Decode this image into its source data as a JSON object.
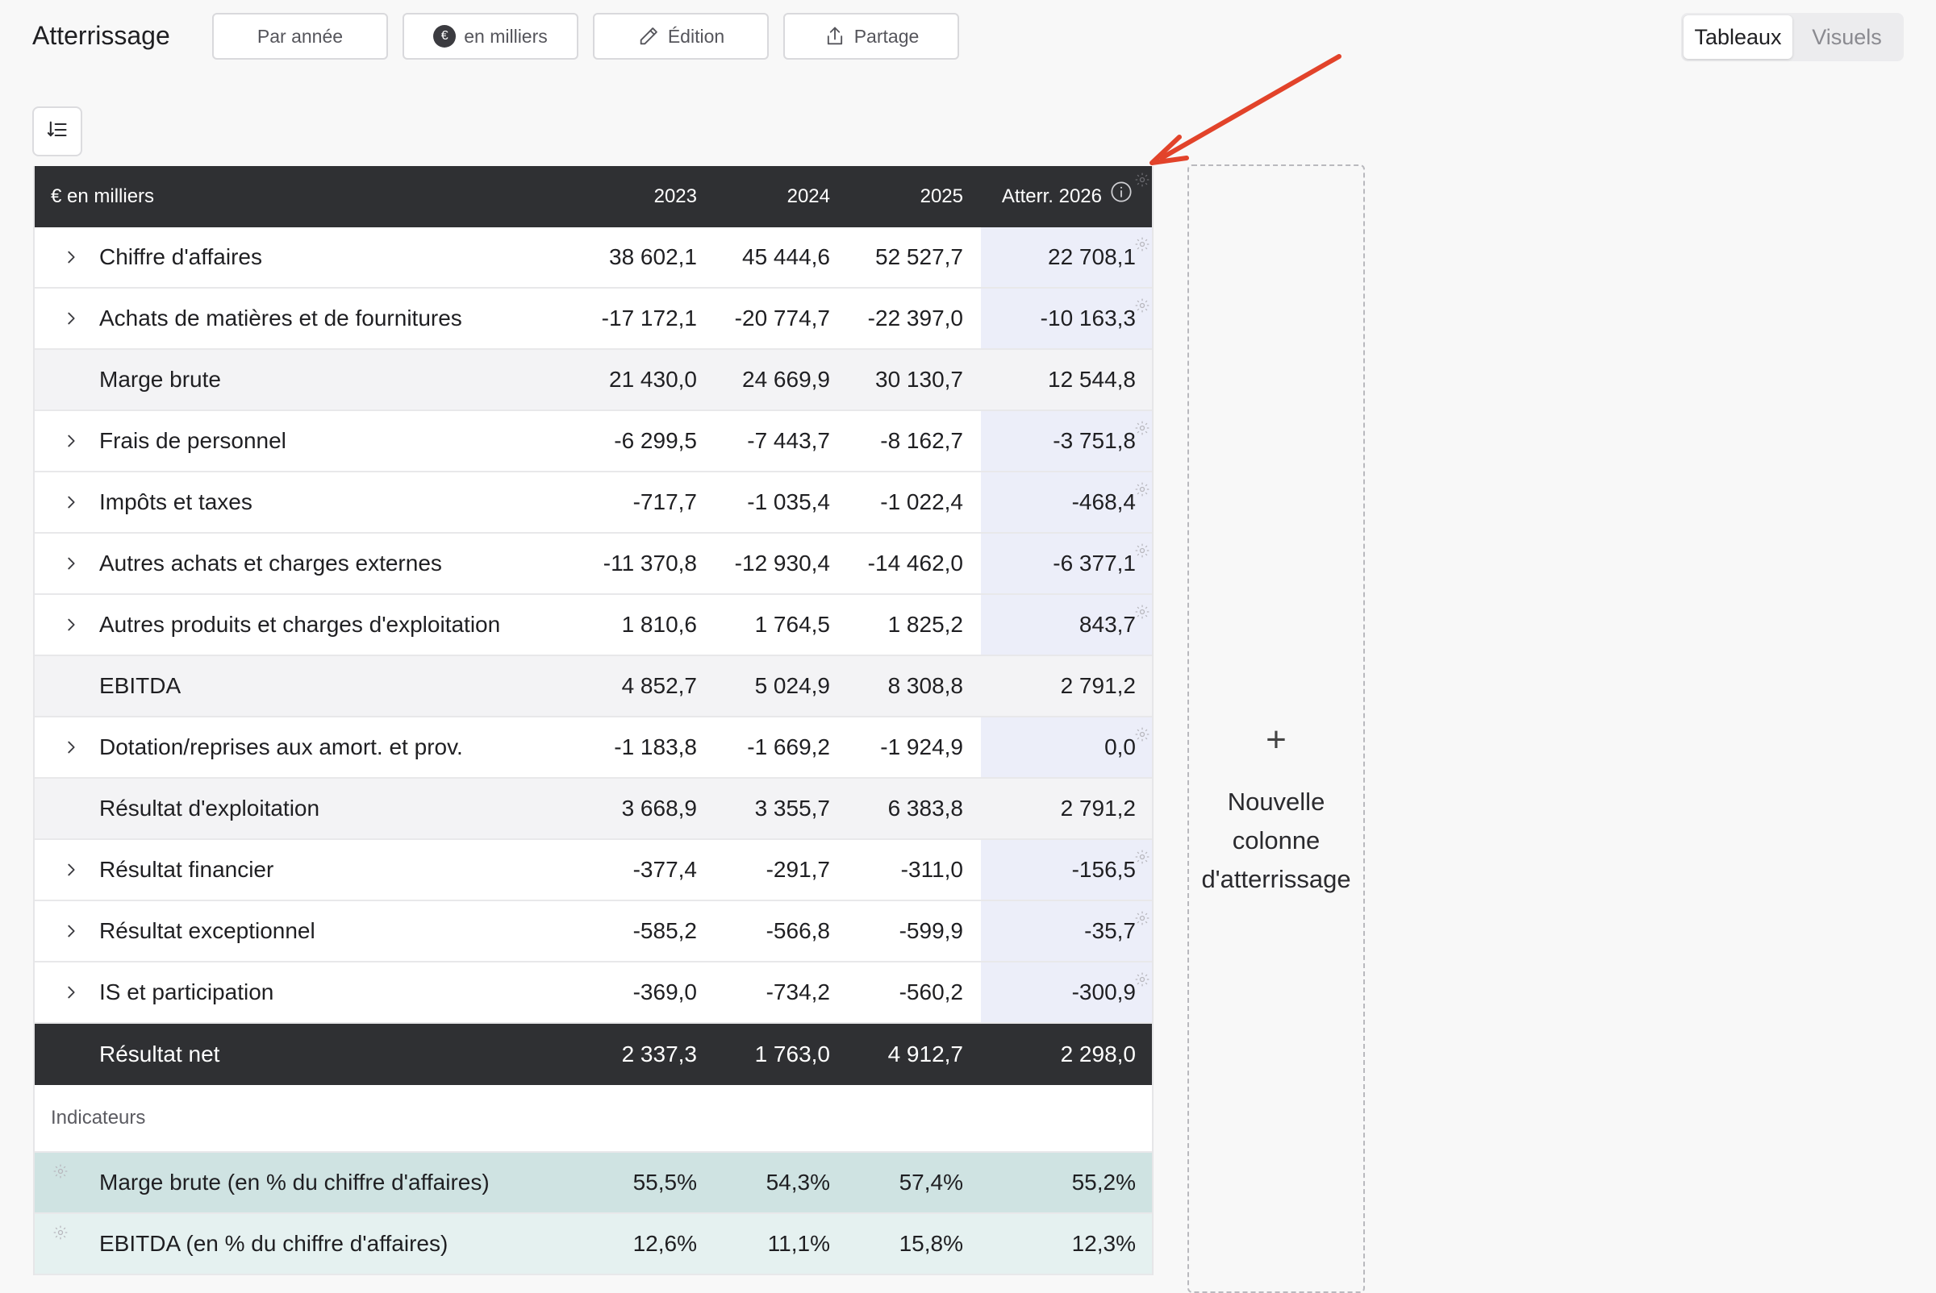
{
  "header": {
    "title": "Atterrissage",
    "buttons": {
      "par_annee": "Par année",
      "en_milliers": "en milliers",
      "edition": "Édition",
      "partage": "Partage"
    },
    "euro_symbol": "€",
    "view_toggle": {
      "tableaux": "Tableaux",
      "visuels": "Visuels",
      "active": "Tableaux"
    }
  },
  "table": {
    "unit_label": "€ en milliers",
    "columns": [
      "2023",
      "2024",
      "2025",
      "Atterr. 2026"
    ],
    "rows": [
      {
        "label": "Chiffre d'affaires",
        "values": [
          "38 602,1",
          "45 444,6",
          "52 527,7",
          "22 708,1"
        ],
        "type": "expandable"
      },
      {
        "label": "Achats de matières et de fournitures",
        "values": [
          "-17 172,1",
          "-20 774,7",
          "-22 397,0",
          "-10 163,3"
        ],
        "type": "expandable"
      },
      {
        "label": "Marge brute",
        "values": [
          "21 430,0",
          "24 669,9",
          "30 130,7",
          "12 544,8"
        ],
        "type": "subtotal"
      },
      {
        "label": "Frais de personnel",
        "values": [
          "-6 299,5",
          "-7 443,7",
          "-8 162,7",
          "-3 751,8"
        ],
        "type": "expandable"
      },
      {
        "label": "Impôts et taxes",
        "values": [
          "-717,7",
          "-1 035,4",
          "-1 022,4",
          "-468,4"
        ],
        "type": "expandable"
      },
      {
        "label": "Autres achats et charges externes",
        "values": [
          "-11 370,8",
          "-12 930,4",
          "-14 462,0",
          "-6 377,1"
        ],
        "type": "expandable"
      },
      {
        "label": "Autres produits et charges d'exploitation",
        "values": [
          "1 810,6",
          "1 764,5",
          "1 825,2",
          "843,7"
        ],
        "type": "expandable"
      },
      {
        "label": "EBITDA",
        "values": [
          "4 852,7",
          "5 024,9",
          "8 308,8",
          "2 791,2"
        ],
        "type": "subtotal"
      },
      {
        "label": "Dotation/reprises aux amort. et prov.",
        "values": [
          "-1 183,8",
          "-1 669,2",
          "-1 924,9",
          "0,0"
        ],
        "type": "expandable"
      },
      {
        "label": "Résultat d'exploitation",
        "values": [
          "3 668,9",
          "3 355,7",
          "6 383,8",
          "2 791,2"
        ],
        "type": "subtotal"
      },
      {
        "label": "Résultat financier",
        "values": [
          "-377,4",
          "-291,7",
          "-311,0",
          "-156,5"
        ],
        "type": "expandable"
      },
      {
        "label": "Résultat exceptionnel",
        "values": [
          "-585,2",
          "-566,8",
          "-599,9",
          "-35,7"
        ],
        "type": "expandable"
      },
      {
        "label": "IS et participation",
        "values": [
          "-369,0",
          "-734,2",
          "-560,2",
          "-300,9"
        ],
        "type": "expandable"
      }
    ],
    "net": {
      "label": "Résultat net",
      "values": [
        "2 337,3",
        "1 763,0",
        "4 912,7",
        "2 298,0"
      ]
    },
    "indicators_title": "Indicateurs",
    "indicators": [
      {
        "label": "Marge brute (en % du chiffre d'affaires)",
        "values": [
          "55,5%",
          "54,3%",
          "57,4%",
          "55,2%"
        ]
      },
      {
        "label": "EBITDA (en % du chiffre d'affaires)",
        "values": [
          "12,6%",
          "11,1%",
          "15,8%",
          "12,3%"
        ]
      }
    ]
  },
  "new_column": {
    "plus": "+",
    "label_line1": "Nouvelle",
    "label_line2": "colonne",
    "label_line3": "d'atterrissage"
  },
  "colors": {
    "header_bg": "#2f3033",
    "highlight_col": "#eceef9",
    "indicator_bg": "#cfe3e2",
    "annotation_arrow": "#e2432a"
  }
}
